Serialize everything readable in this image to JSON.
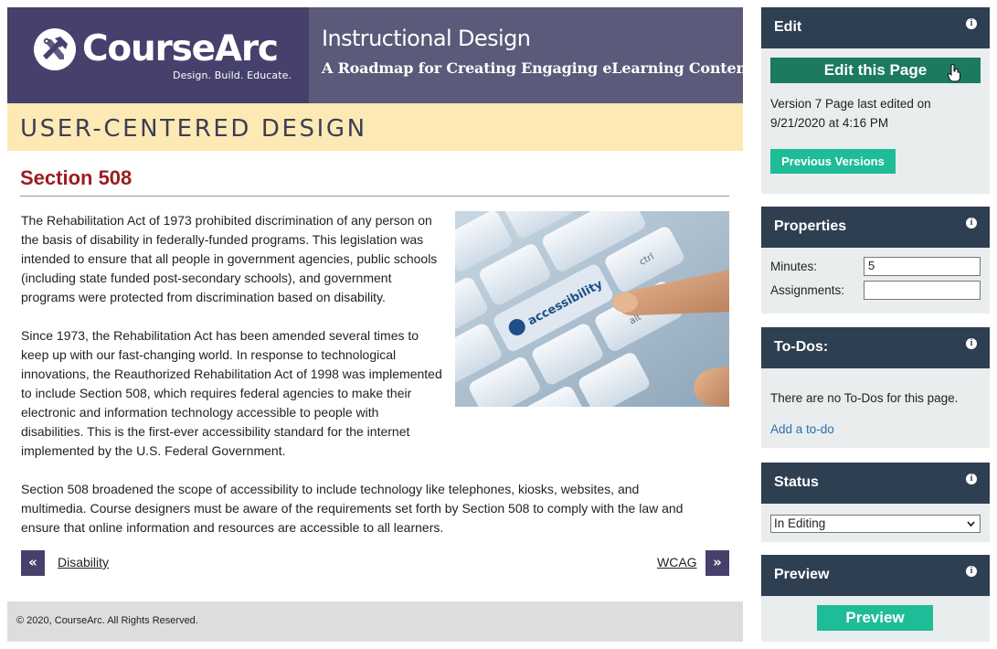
{
  "header": {
    "logo_name": "CourseArc",
    "logo_tagline": "Design. Build. Educate.",
    "course_title": "Instructional Design",
    "course_subtitle": "A Roadmap for Creating Engaging eLearning Content"
  },
  "module": {
    "title": "USER-CENTERED DESIGN"
  },
  "content": {
    "section_title": "Section 508",
    "paragraphs": [
      "The Rehabilitation Act of 1973 prohibited discrimination of any person on the basis of disability in federally-funded programs. This legislation was intended to ensure that all people in government agencies, public schools (including state funded post-secondary schools), and government programs were protected from discrimination based on disability.",
      "Since 1973, the Rehabilitation Act has been amended several times to keep up with our fast-changing world. In response to technological innovations, the Reauthorized Rehabilitation Act of 1998 was implemented to include Section 508, which requires federal agencies to make their electronic and information technology accessible to people with disabilities. This is the first-ever accessibility standard for the internet implemented by the U.S. Federal Government.",
      "Section 508 broadened the scope of accessibility to include technology like telephones, kiosks, websites, and multimedia. Course designers must be aware of the requirements set forth by Section 508 to comply with the law and ensure that online information and resources are accessible to all learners."
    ],
    "image_key_label": "accessibility",
    "image_keys": [
      "ctrl",
      "alt"
    ]
  },
  "pager": {
    "prev_icon": "«",
    "prev_label": "Disability",
    "next_icon": "»",
    "next_label": "WCAG"
  },
  "footer": {
    "copyright": "© 2020, CourseArc. All Rights Reserved."
  },
  "sidebar": {
    "edit": {
      "title": "Edit",
      "info_icon": "i",
      "edit_button": "Edit this Page",
      "version_text": "Version 7   Page last edited on 9/21/2020 at 4:16 PM",
      "previous_versions_button": "Previous Versions"
    },
    "properties": {
      "title": "Properties",
      "info_icon": "i",
      "minutes_label": "Minutes:",
      "minutes_value": "5",
      "assignments_label": "Assignments:",
      "assignments_value": ""
    },
    "todos": {
      "title": "To-Dos:",
      "info_icon": "i",
      "empty_text": "There are no To-Dos for this page.",
      "add_link": "Add a to-do"
    },
    "status": {
      "title": "Status",
      "info_icon": "i",
      "selected": "In Editing"
    },
    "preview": {
      "title": "Preview",
      "info_icon": "i",
      "button": "Preview"
    }
  },
  "colors": {
    "header_bg": "#5b5a7a",
    "logo_bg": "#45416c",
    "module_band": "#fde9b4",
    "section_title": "#9b1c1f",
    "panel_head": "#2f3f52",
    "panel_body": "#e9eded",
    "edit_button": "#1b7a5f",
    "accent_button": "#1ebc97",
    "link": "#2a6fb0"
  }
}
